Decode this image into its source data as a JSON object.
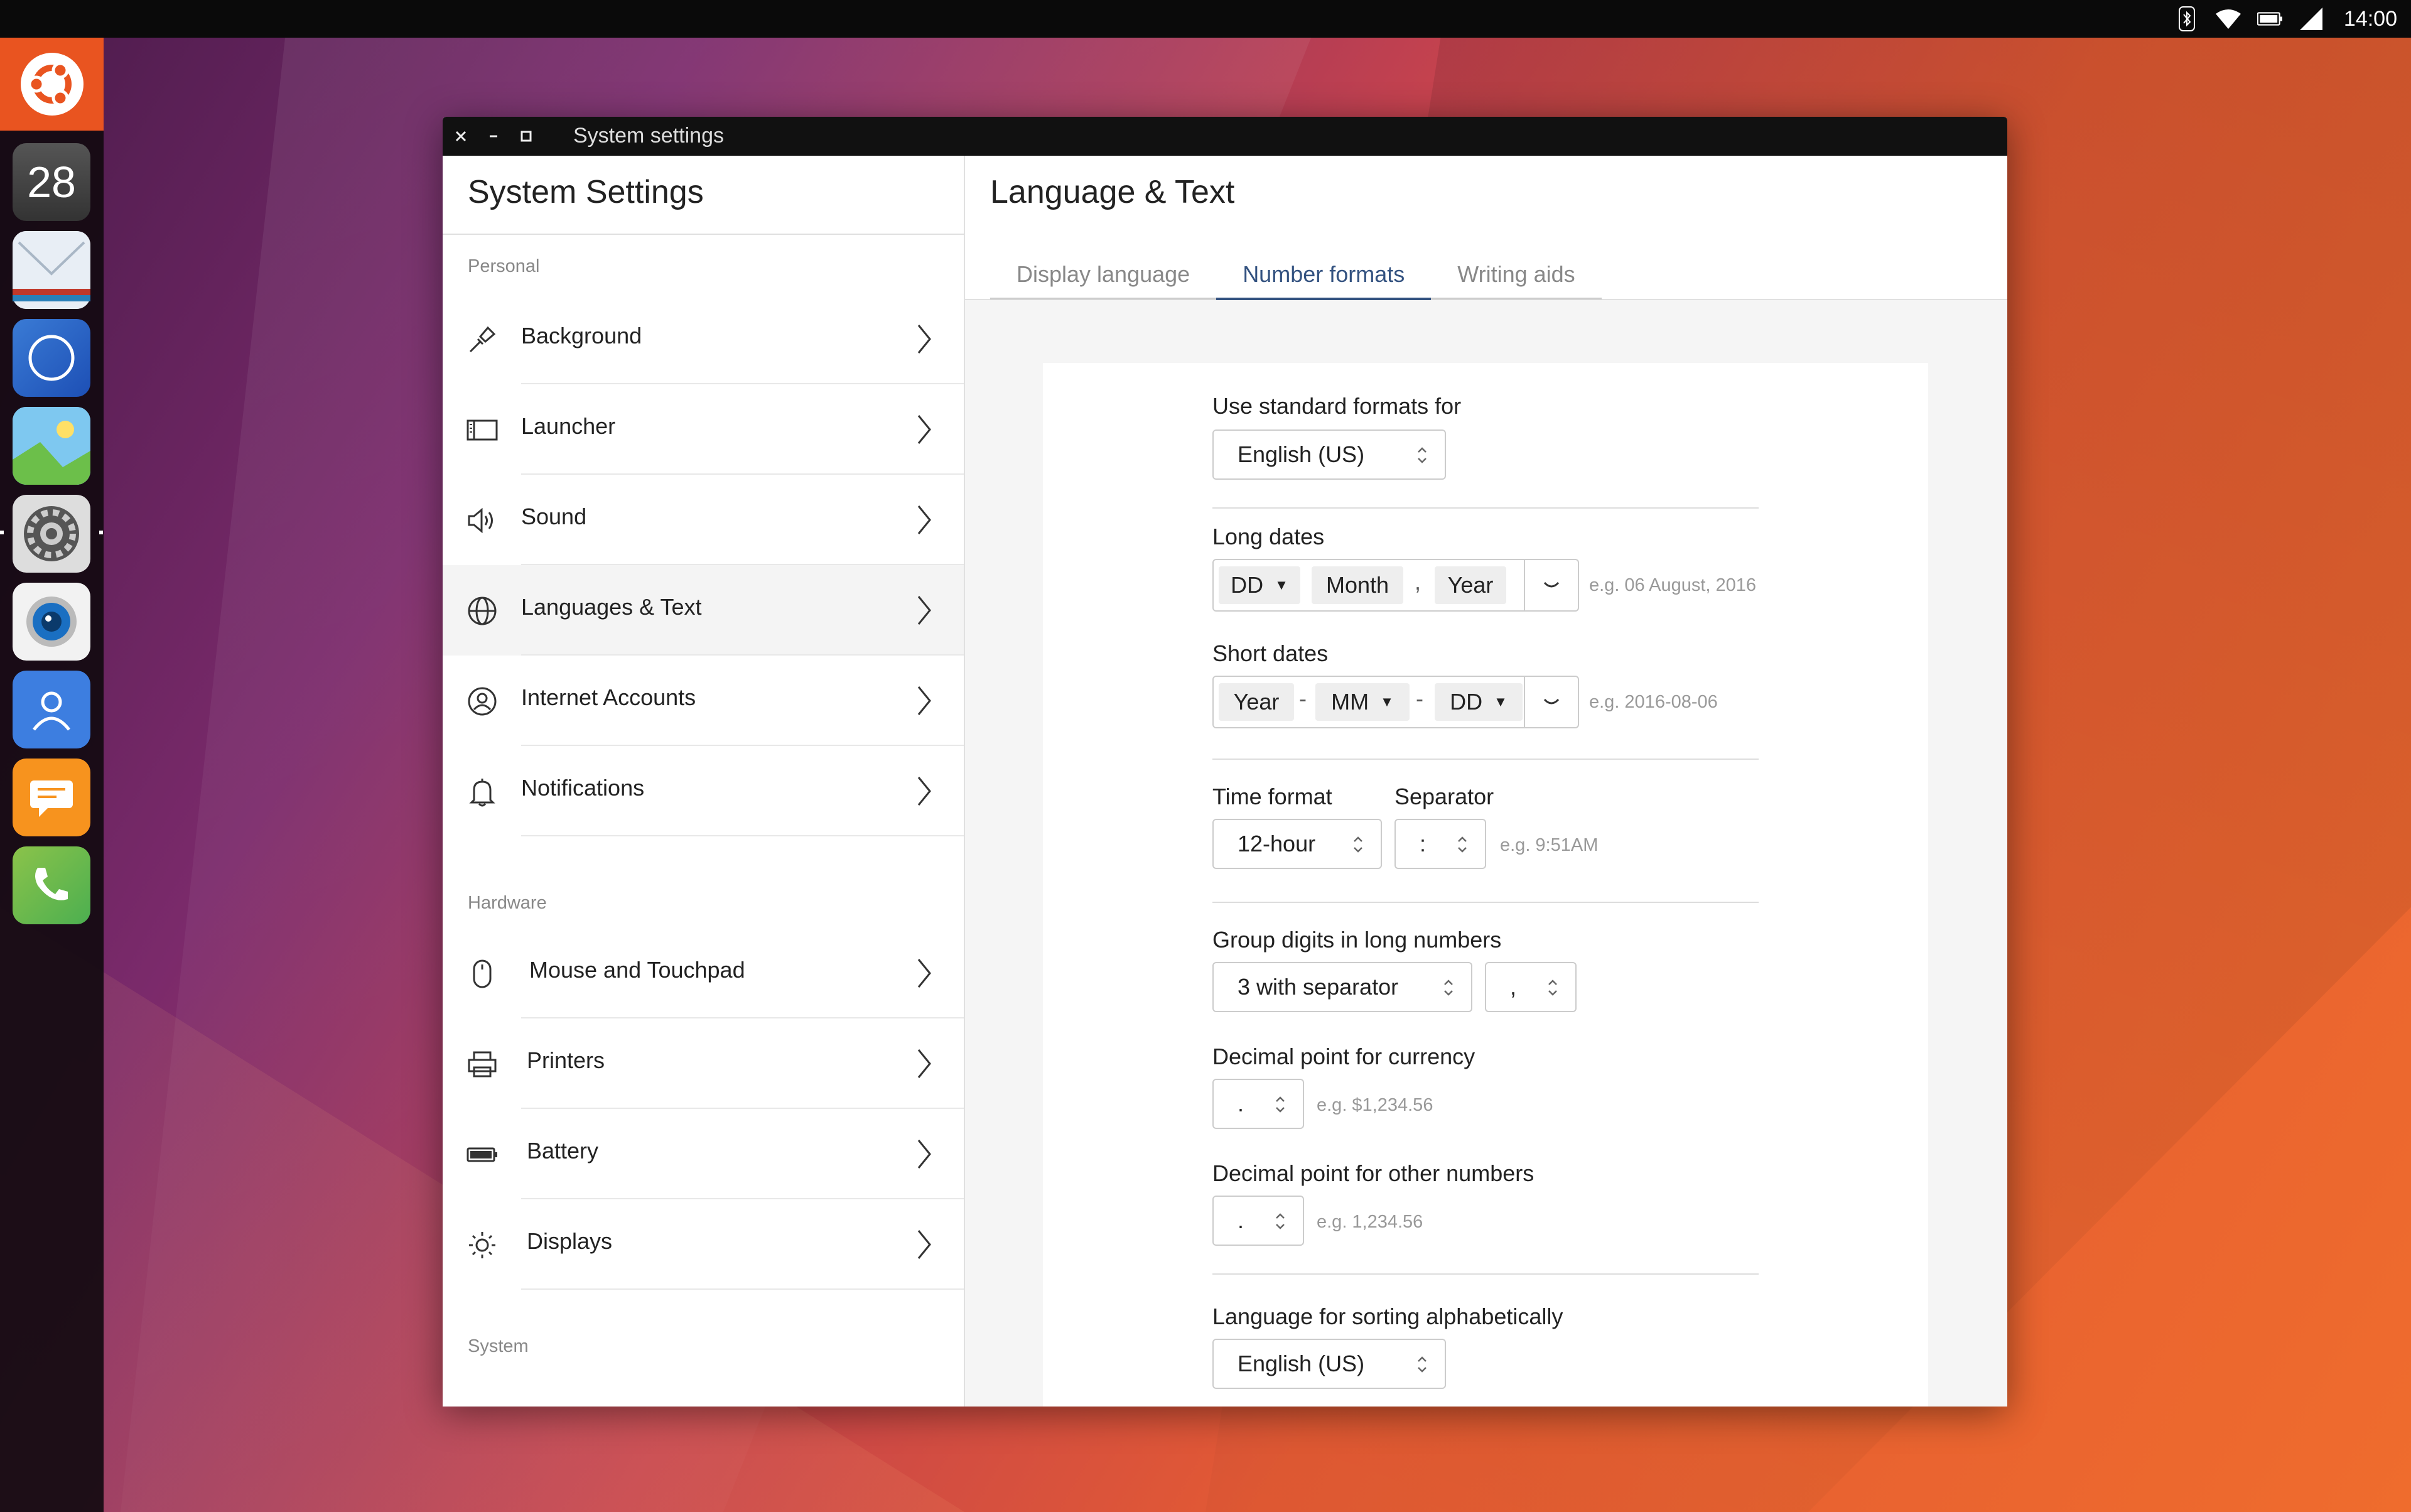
{
  "top_panel": {
    "clock": "14:00",
    "indicator_icons": [
      "bluetooth-icon",
      "wifi-icon",
      "battery-icon",
      "signal-icon"
    ]
  },
  "launcher": {
    "calendar_day": "28",
    "apps": [
      "ubuntu-icon",
      "calendar-icon",
      "mail-icon",
      "browser-icon",
      "gallery-icon",
      "settings-icon",
      "camera-icon",
      "contacts-icon",
      "messaging-icon",
      "phone-icon"
    ]
  },
  "window": {
    "title": "System settings"
  },
  "left": {
    "title": "System Settings",
    "sections": [
      {
        "label": "Personal"
      },
      {
        "label": "Hardware"
      },
      {
        "label": "System"
      }
    ],
    "items": [
      {
        "label": "Background",
        "icon": "paintbrush-icon"
      },
      {
        "label": "Launcher",
        "icon": "launcher-icon"
      },
      {
        "label": "Sound",
        "icon": "speaker-icon"
      },
      {
        "label": "Languages & Text",
        "icon": "globe-icon"
      },
      {
        "label": "Internet Accounts",
        "icon": "account-icon"
      },
      {
        "label": "Notifications",
        "icon": "bell-icon"
      },
      {
        "label": "Mouse and Touchpad",
        "icon": "mouse-icon"
      },
      {
        "label": "Printers",
        "icon": "printer-icon"
      },
      {
        "label": "Battery",
        "icon": "battery-icon"
      },
      {
        "label": "Displays",
        "icon": "brightness-icon"
      }
    ]
  },
  "right": {
    "title": "Language & Text",
    "tabs": [
      {
        "label": "Display language"
      },
      {
        "label": "Number formats"
      },
      {
        "label": "Writing aids"
      }
    ],
    "standard_formats": {
      "label": "Use standard formats for",
      "value": "English (US)"
    },
    "long_dates": {
      "label": "Long dates",
      "parts": [
        "DD",
        "Month",
        "Year"
      ],
      "separator": ",",
      "example": "e.g. 06 August, 2016"
    },
    "short_dates": {
      "label": "Short dates",
      "parts": [
        "Year",
        "MM",
        "DD"
      ],
      "separator": "-",
      "example": "e.g. 2016-08-06"
    },
    "time_format": {
      "label": "Time format",
      "value": "12-hour",
      "separator_label": "Separator",
      "separator_value": ":",
      "example": "e.g. 9:51AM"
    },
    "group_digits": {
      "label": "Group digits in long numbers",
      "value": "3 with separator",
      "separator_value": ","
    },
    "decimal_currency": {
      "label": "Decimal point for currency",
      "value": ".",
      "example": "e.g. $1,234.56"
    },
    "decimal_other": {
      "label": "Decimal point for other numbers",
      "value": ".",
      "example": "e.g. 1,234.56"
    },
    "sorting": {
      "label": "Language for sorting alphabetically",
      "value": "English (US)"
    }
  }
}
